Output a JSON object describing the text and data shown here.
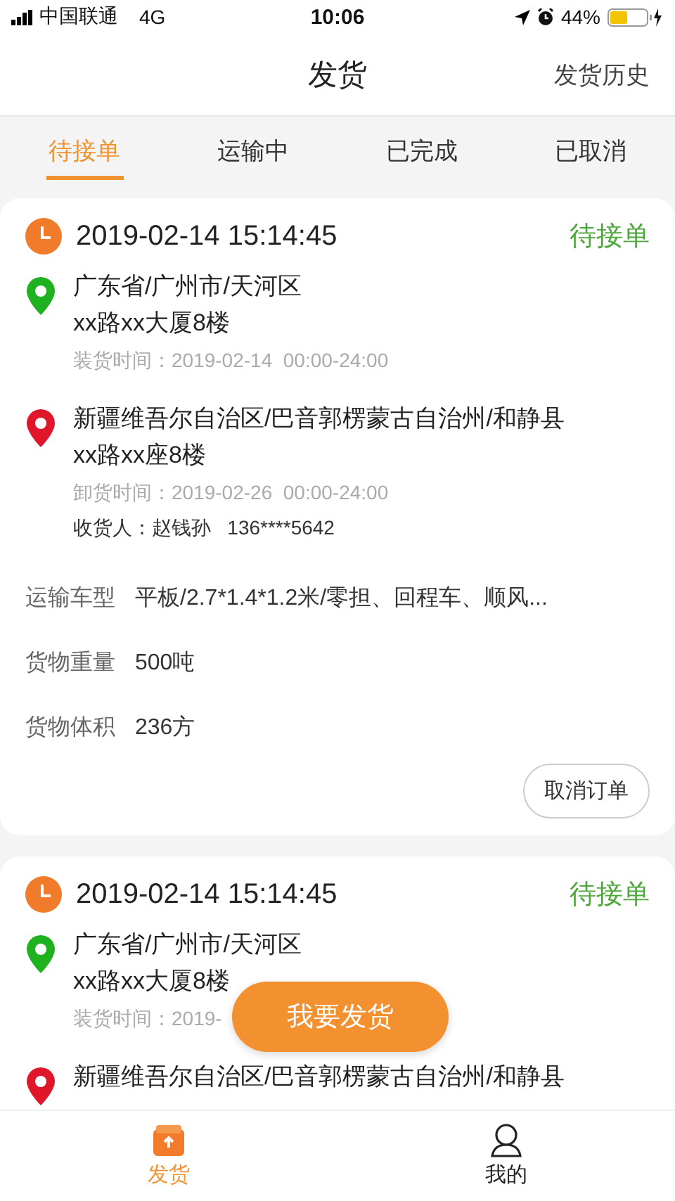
{
  "status_bar": {
    "carrier": "中国联通",
    "network": "4G",
    "time": "10:06",
    "battery": "44%"
  },
  "nav": {
    "title": "发货",
    "action": "发货历史"
  },
  "tabs": [
    {
      "label": "待接单",
      "selected": true
    },
    {
      "label": "运输中",
      "selected": false
    },
    {
      "label": "已完成",
      "selected": false
    },
    {
      "label": "已取消",
      "selected": false
    }
  ],
  "orders": [
    {
      "time": "2019-02-14 15:14:45",
      "status": "待接单",
      "stops": [
        {
          "kind": "pickup",
          "address": "广东省/广州市/天河区",
          "detail": "xx路xx大厦8楼",
          "time_label": "装货时间：2019-02-14  00:00-24:00"
        },
        {
          "kind": "delivery",
          "address": "新疆维吾尔自治区/巴音郭楞蒙古自治州/和静县",
          "detail": "xx路xx座8楼",
          "time_label": "卸货时间：2019-02-26  00:00-24:00",
          "receiver": "收货人：赵钱孙   136****5642"
        }
      ],
      "specs": [
        {
          "label": "运输车型",
          "value": "平板/2.7*1.4*1.2米/零担、回程车、顺风..."
        },
        {
          "label": "货物重量",
          "value": "500吨"
        },
        {
          "label": "货物体积",
          "value": "236方"
        }
      ],
      "action": "取消订单"
    },
    {
      "time": "2019-02-14 15:14:45",
      "status": "待接单",
      "stops": [
        {
          "kind": "pickup",
          "address": "广东省/广州市/天河区",
          "detail": "xx路xx大厦8楼",
          "time_label": "装货时间：2019-"
        },
        {
          "kind": "delivery",
          "address": "新疆维吾尔自治区/巴音郭楞蒙古自治州/和静县"
        }
      ]
    }
  ],
  "fab": "我要发货",
  "bottom_tabs": [
    {
      "kind": "ship",
      "label": "发货",
      "selected": true
    },
    {
      "kind": "me",
      "label": "我的",
      "selected": false
    }
  ]
}
